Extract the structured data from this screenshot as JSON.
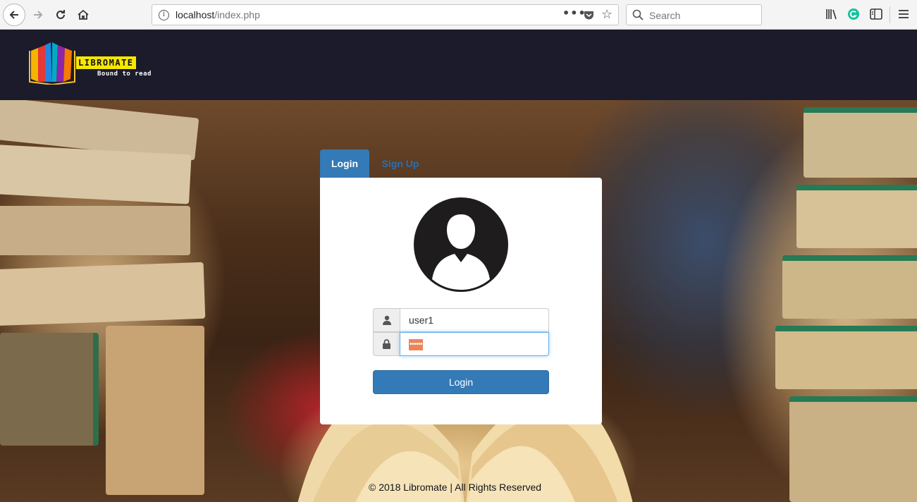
{
  "browser": {
    "url_host": "localhost",
    "url_path": "/index.php",
    "search_placeholder": "Search",
    "url_dots": "•••"
  },
  "site": {
    "logo_name": "LIBROMATE",
    "logo_tagline": "Bound to read"
  },
  "tabs": [
    {
      "label": "Login",
      "active": true
    },
    {
      "label": "Sign Up",
      "active": false
    }
  ],
  "login_form": {
    "username_value": "user1",
    "password_mask": "••••••",
    "submit_label": "Login"
  },
  "footer": {
    "text": "© 2018 Libromate | All Rights Reserved"
  },
  "colors": {
    "header_bg": "#1c1b2b",
    "primary": "#337ab7",
    "logo_yellow": "#f5e800"
  }
}
